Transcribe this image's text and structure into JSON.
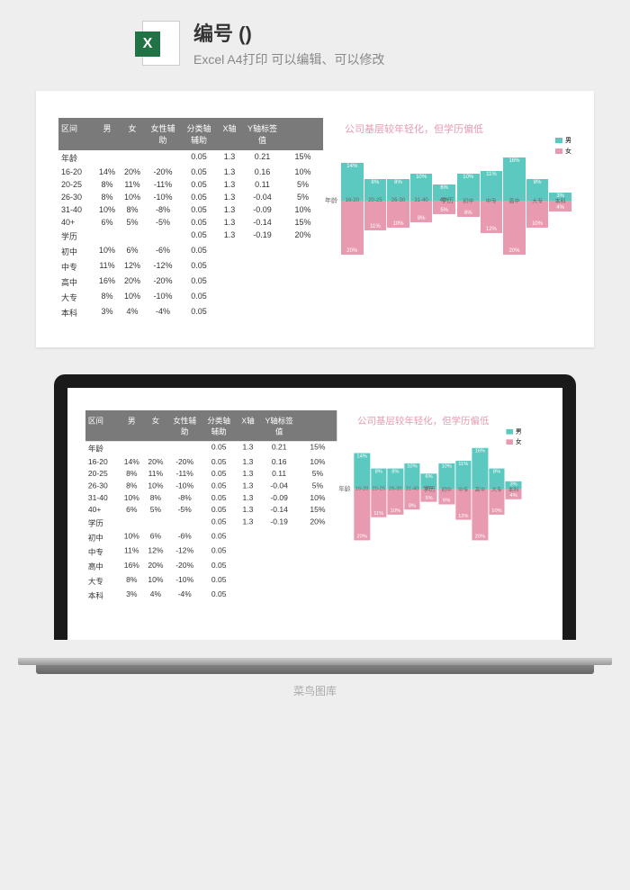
{
  "header": {
    "title": "编号 ()",
    "subtitle": "Excel A4打印 可以编辑、可以修改"
  },
  "table": {
    "headers": [
      "区间",
      "男",
      "女",
      "女性辅助",
      "分类轴辅助",
      "X轴",
      "Y轴标签值"
    ],
    "section1": "年龄",
    "section2": "学历",
    "rows_age": [
      {
        "label": "年龄",
        "male": "",
        "female": "",
        "aux": "",
        "cat": "0.05",
        "x": "1.3",
        "y": "0.21",
        "pct": "15%"
      },
      {
        "label": "16-20",
        "male": "14%",
        "female": "20%",
        "aux": "-20%",
        "cat": "0.05",
        "x": "1.3",
        "y": "0.16",
        "pct": "10%"
      },
      {
        "label": "20-25",
        "male": "8%",
        "female": "11%",
        "aux": "-11%",
        "cat": "0.05",
        "x": "1.3",
        "y": "0.11",
        "pct": "5%"
      },
      {
        "label": "26-30",
        "male": "8%",
        "female": "10%",
        "aux": "-10%",
        "cat": "0.05",
        "x": "1.3",
        "y": "-0.04",
        "pct": "5%"
      },
      {
        "label": "31-40",
        "male": "10%",
        "female": "8%",
        "aux": "-8%",
        "cat": "0.05",
        "x": "1.3",
        "y": "-0.09",
        "pct": "10%"
      },
      {
        "label": "40+",
        "male": "6%",
        "female": "5%",
        "aux": "-5%",
        "cat": "0.05",
        "x": "1.3",
        "y": "-0.14",
        "pct": "15%"
      },
      {
        "label": "学历",
        "male": "",
        "female": "",
        "aux": "",
        "cat": "0.05",
        "x": "1.3",
        "y": "-0.19",
        "pct": "20%"
      }
    ],
    "rows_edu": [
      {
        "label": "初中",
        "male": "10%",
        "female": "6%",
        "aux": "-6%",
        "cat": "0.05",
        "x": "",
        "y": "",
        "pct": ""
      },
      {
        "label": "中专",
        "male": "11%",
        "female": "12%",
        "aux": "-12%",
        "cat": "0.05",
        "x": "",
        "y": "",
        "pct": ""
      },
      {
        "label": "高中",
        "male": "16%",
        "female": "20%",
        "aux": "-20%",
        "cat": "0.05",
        "x": "",
        "y": "",
        "pct": ""
      },
      {
        "label": "大专",
        "male": "8%",
        "female": "10%",
        "aux": "-10%",
        "cat": "0.05",
        "x": "",
        "y": "",
        "pct": ""
      },
      {
        "label": "本科",
        "male": "3%",
        "female": "4%",
        "aux": "-4%",
        "cat": "0.05",
        "x": "",
        "y": "",
        "pct": ""
      }
    ]
  },
  "chart_data": {
    "type": "bar",
    "title": "公司基层较年轻化，但学历偏低",
    "legend": {
      "male": "男",
      "female": "女"
    },
    "sections": [
      {
        "name": "年龄",
        "categories": [
          "16-20",
          "20-25",
          "26-30",
          "31-40",
          "40+"
        ],
        "series": [
          {
            "name": "男",
            "values": [
              14,
              8,
              8,
              10,
              6
            ]
          },
          {
            "name": "女",
            "values": [
              20,
              11,
              10,
              8,
              5
            ]
          }
        ]
      },
      {
        "name": "学历",
        "categories": [
          "初中",
          "中专",
          "高中",
          "大专",
          "本科"
        ],
        "series": [
          {
            "name": "男",
            "values": [
              10,
              11,
              16,
              8,
              3
            ]
          },
          {
            "name": "女",
            "values": [
              6,
              12,
              20,
              10,
              4
            ]
          }
        ]
      }
    ],
    "ylim": [
      -20,
      20
    ]
  },
  "watermark": "菜鸟图库"
}
